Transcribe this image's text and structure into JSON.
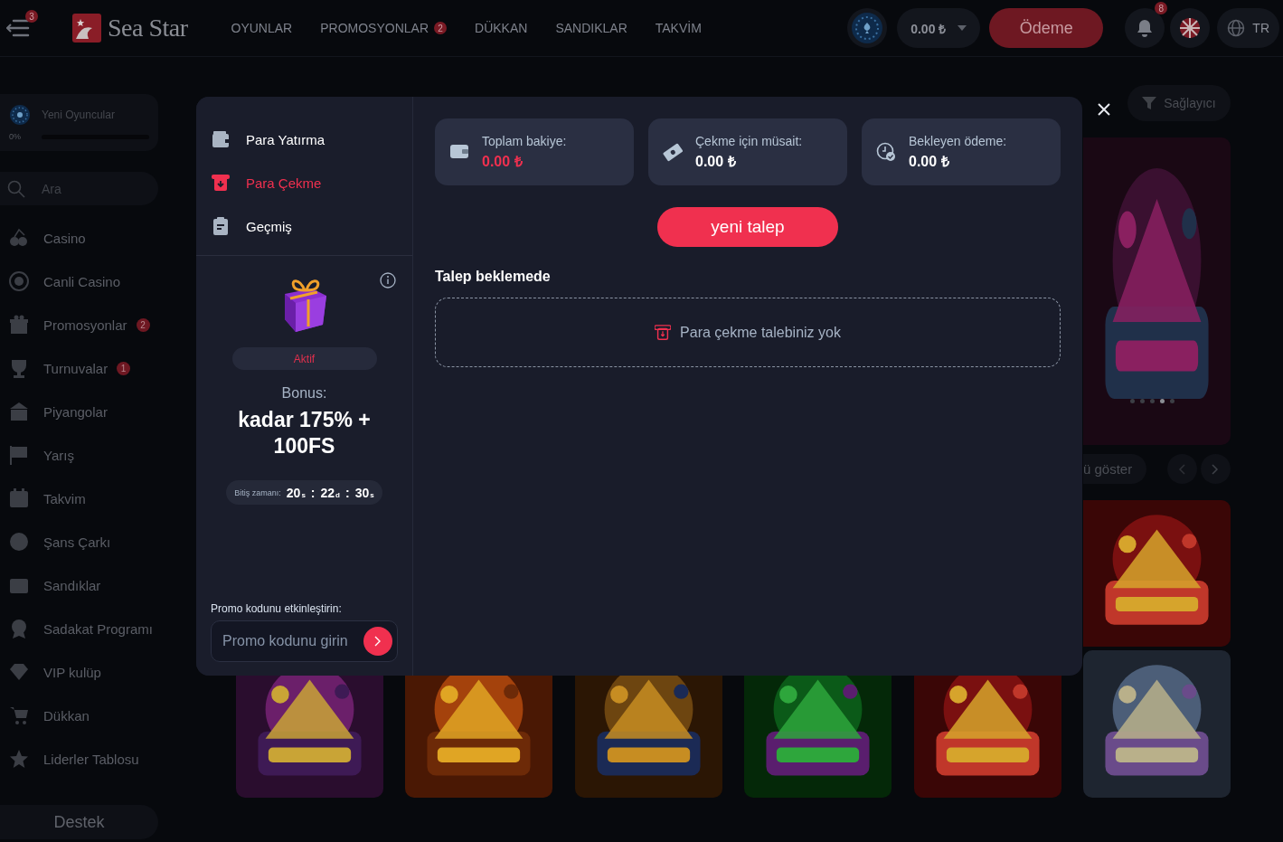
{
  "header": {
    "menu_badge": "3",
    "logo": "Sea Star",
    "nav": [
      {
        "label": "OYUNLAR"
      },
      {
        "label": "PROMOSYONLAR",
        "badge": "2"
      },
      {
        "label": "DÜKKAN"
      },
      {
        "label": "SANDIKLAR"
      },
      {
        "label": "TAKVİM"
      }
    ],
    "balance": "0.00 ₺",
    "payment_button": "Ödeme",
    "notification_badge": "8",
    "language": "TR"
  },
  "sidebar": {
    "progress": {
      "label": "Yeni Oyuncular",
      "percent": "0%",
      "level": 0
    },
    "search": {
      "placeholder": "Ara"
    },
    "items": [
      {
        "label": "Casino"
      },
      {
        "label": "Canli Casino"
      },
      {
        "label": "Promosyonlar",
        "badge": "2"
      },
      {
        "label": "Turnuvalar",
        "badge": "1"
      },
      {
        "label": "Piyangolar"
      },
      {
        "label": "Yarış"
      },
      {
        "label": "Takvim"
      },
      {
        "label": "Şans Çarkı"
      },
      {
        "label": "Sandıklar"
      },
      {
        "label": "Sadakat Programı"
      },
      {
        "label": "VIP kulüp"
      },
      {
        "label": "Dükkan"
      },
      {
        "label": "Liderler Tablosu"
      }
    ],
    "support_button": "Destek"
  },
  "games_area": {
    "provider_button": "Sağlayıcı",
    "show_all_button": "ü göster",
    "banner": {
      "kind": "picture",
      "dots": [
        {
          "selected": false
        },
        {
          "selected": false
        },
        {
          "selected": false
        },
        {
          "selected": true
        },
        {
          "selected": false
        }
      ]
    }
  },
  "modal": {
    "menu": [
      {
        "label": "Para Yatırma",
        "selected": false
      },
      {
        "label": "Para Çekme",
        "selected": true
      },
      {
        "label": "Geçmiş",
        "selected": false
      }
    ],
    "bonus": {
      "status": "Aktif",
      "label": "Bonus:",
      "title": "kadar 175% + 100FS",
      "timer": {
        "label": "Bitiş zamanı:",
        "separator": ":",
        "parts": [
          {
            "value": "20",
            "unit": "s"
          },
          {
            "value": "22",
            "unit": "d"
          },
          {
            "value": "30",
            "unit": "s"
          }
        ]
      }
    },
    "promo": {
      "label": "Promo kodunu etkinleştirin:",
      "placeholder": "Promo kodunu girin"
    },
    "stats": [
      {
        "kind": "wallet",
        "label": "Toplam bakiye:",
        "value": "0.00 ₺",
        "highlighted": true
      },
      {
        "kind": "cash",
        "label": "Çekme için müsait:",
        "value": "0.00 ₺",
        "highlighted": false
      },
      {
        "kind": "clock",
        "label": "Bekleyen ödeme:",
        "value": "0.00 ₺",
        "highlighted": false
      }
    ],
    "new_request_button": "yeni talep",
    "pending_title": "Talep beklemede",
    "empty_message": "Para çekme talebiniz yok"
  }
}
